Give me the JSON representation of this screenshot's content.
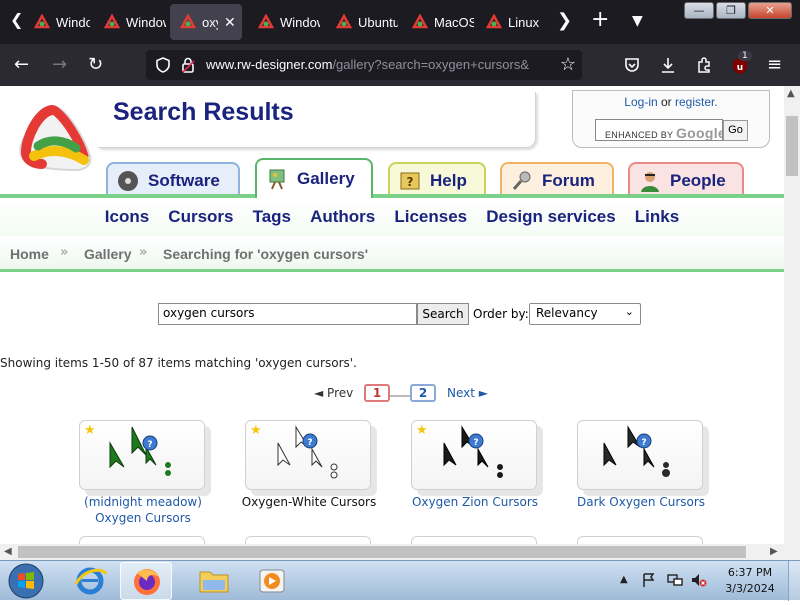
{
  "browser": {
    "tabs": [
      {
        "title": "Windows",
        "active": false
      },
      {
        "title": "Windows",
        "active": false
      },
      {
        "title": "oxygen",
        "active": true
      },
      {
        "title": "Windows",
        "active": false
      },
      {
        "title": "Ubuntu",
        "active": false
      },
      {
        "title": "MacOS",
        "active": false
      },
      {
        "title": "Linux",
        "active": false
      }
    ],
    "url_host": "www.rw-designer.com",
    "url_path": "/gallery?search=oxygen+cursors&",
    "extension_badge": "1",
    "window_close": "✕",
    "window_minimize": "—",
    "window_maximize": "❐"
  },
  "site": {
    "title": "Search Results",
    "login_label": "Log-in",
    "login_or": "or",
    "register_label": "register.",
    "google_search_label": "ENHANCED BY",
    "google_word": "Google",
    "go_label": "Go",
    "tabs": [
      "Software",
      "Gallery",
      "Help",
      "Forum",
      "People"
    ],
    "subnav": [
      "Icons",
      "Cursors",
      "Tags",
      "Authors",
      "Licenses",
      "Design services",
      "Links"
    ],
    "breadcrumb": [
      "Home",
      "Gallery",
      "Searching for 'oxygen cursors'"
    ]
  },
  "search": {
    "query": "oxygen cursors",
    "button": "Search",
    "order_label": "Order by:",
    "order_value": "Relevancy"
  },
  "results": {
    "summary": "Showing items 1-50 of 87 items matching 'oxygen cursors'.",
    "prev": "◄ Prev",
    "next": "Next ►",
    "page1": "1",
    "page2": "2",
    "items": [
      {
        "title": "(midnight meadow) Oxygen Cursors",
        "featured": true,
        "color": "#1e7a1e"
      },
      {
        "title": "Oxygen-White Cursors",
        "featured": true,
        "color": "#ffffff"
      },
      {
        "title": "Oxygen Zion Cursors",
        "featured": true,
        "color": "#1a1a1a"
      },
      {
        "title": "Dark Oxygen Cursors",
        "featured": false,
        "color": "#2a2a2a"
      }
    ]
  },
  "taskbar": {
    "time": "6:37 PM",
    "date": "3/3/2024"
  }
}
